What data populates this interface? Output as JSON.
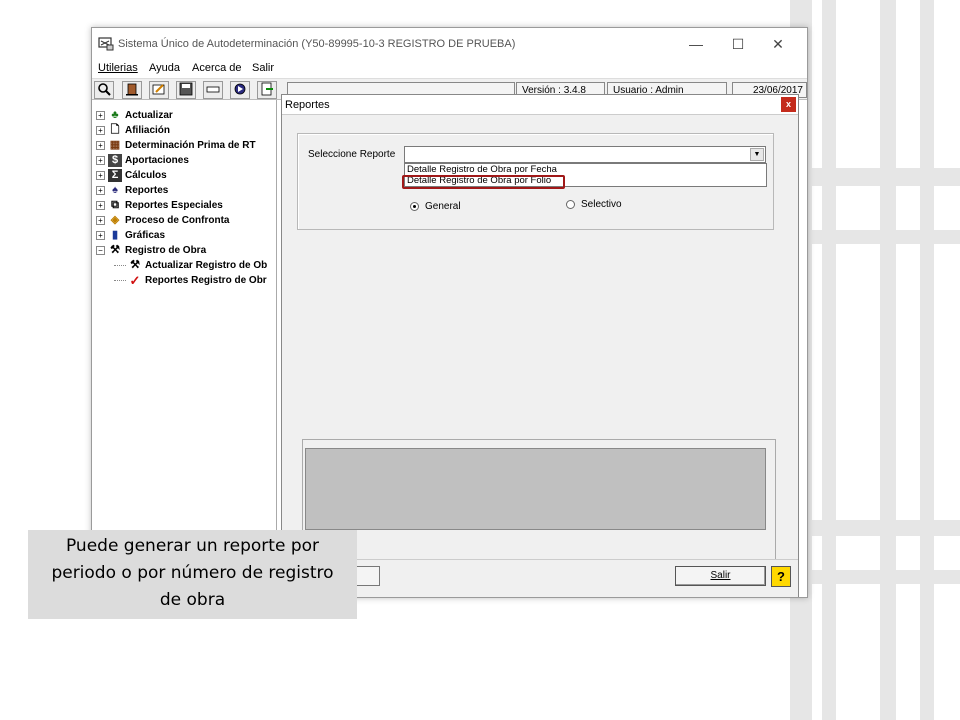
{
  "main_window": {
    "title": "Sistema Único de Autodeterminación (Y50-89995-10-3  REGISTRO DE PRUEBA)",
    "minimize_glyph": "—",
    "maximize_glyph": "☐",
    "close_glyph": "✕"
  },
  "menu": {
    "utilerias": "Utilerias",
    "ayuda": "Ayuda",
    "acerca_de": "Acerca de",
    "salir": "Salir"
  },
  "status": {
    "version": "Versión : 3.4.8",
    "usuario": "Usuario : Admin",
    "fecha": "23/06/2017"
  },
  "tree": {
    "items": [
      {
        "label": "Actualizar",
        "icon": "update-icon"
      },
      {
        "label": "Afiliación",
        "icon": "document-icon"
      },
      {
        "label": "Determinación Prima de RT",
        "icon": "chart-icon"
      },
      {
        "label": "Aportaciones",
        "icon": "dollar-icon"
      },
      {
        "label": "Cálculos",
        "icon": "sigma-icon"
      },
      {
        "label": "Reportes",
        "icon": "report-icon"
      },
      {
        "label": "Reportes Especiales",
        "icon": "copy-icon"
      },
      {
        "label": "Proceso de Confronta",
        "icon": "compare-icon"
      },
      {
        "label": "Gráficas",
        "icon": "bar-chart-icon"
      },
      {
        "label": "Registro de Obra",
        "icon": "tools-icon"
      }
    ],
    "children": [
      {
        "label": "Actualizar Registro de Ob",
        "icon": "tools-icon"
      },
      {
        "label": "Reportes Registro de Obr",
        "icon": "check-icon"
      }
    ]
  },
  "dialog": {
    "title": "Reportes",
    "close": "x",
    "select_label": "Seleccione Reporte",
    "selected_value": "",
    "options": [
      "Detalle Registro de Obra por Fecha",
      "Detalle Registro de Obra por Folio"
    ],
    "radio_general": "General",
    "radio_selectivo": "Selectivo",
    "radio_selected": "General",
    "salir_button": "Salir",
    "help_button": "?"
  },
  "caption": {
    "line1": "Puede generar un reporte por",
    "line2": "periodo o por número de registro",
    "line3": "de obra"
  },
  "colors": {
    "highlight_border": "#a01818",
    "help_button": "#ffd800"
  }
}
